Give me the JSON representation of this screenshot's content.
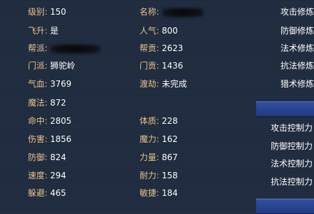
{
  "col1": [
    {
      "key": "level",
      "label": "级别:",
      "value": "150"
    },
    {
      "key": "ascend",
      "label": "飞升:",
      "value": "是"
    },
    {
      "key": "gang",
      "label": "帮派:",
      "value": ""
    },
    {
      "key": "sect",
      "label": "门派:",
      "value": "狮驼岭"
    },
    {
      "key": "hp",
      "label": "气血:",
      "value": "3769"
    },
    {
      "key": "mp",
      "label": "魔法:",
      "value": "872"
    },
    {
      "key": "hit",
      "label": "命中:",
      "value": "2805"
    },
    {
      "key": "damage",
      "label": "伤害:",
      "value": "1856"
    },
    {
      "key": "defense",
      "label": "防御:",
      "value": "824"
    },
    {
      "key": "speed",
      "label": "速度:",
      "value": "294"
    },
    {
      "key": "dodge",
      "label": "躲避:",
      "value": "465"
    }
  ],
  "col2": [
    {
      "key": "name",
      "label": "名称:",
      "value": ""
    },
    {
      "key": "popularity",
      "label": "人气:",
      "value": "800"
    },
    {
      "key": "gang_contrib",
      "label": "帮贡:",
      "value": "2623"
    },
    {
      "key": "sect_contrib",
      "label": "门贡:",
      "value": "1436"
    },
    {
      "key": "crossing",
      "label": "渡劫:",
      "value": "未完成"
    },
    {
      "key": "constitution",
      "label": "体质:",
      "value": "228"
    },
    {
      "key": "magic",
      "label": "魔力:",
      "value": "162"
    },
    {
      "key": "strength",
      "label": "力量:",
      "value": "867"
    },
    {
      "key": "endurance",
      "label": "耐力:",
      "value": "158"
    },
    {
      "key": "agility",
      "label": "敏捷:",
      "value": "184"
    }
  ],
  "cultivation": [
    "攻击修炼",
    "防御修炼",
    "法术修炼",
    "抗法修炼",
    "猎术修炼"
  ],
  "control": [
    "攻击控制力",
    "防御控制力",
    "法术控制力",
    "抗法控制力"
  ],
  "colors": {
    "label": "#e6c28c",
    "value": "#ffffff",
    "background": "#1e2a3d",
    "bar": "#2a4590"
  }
}
